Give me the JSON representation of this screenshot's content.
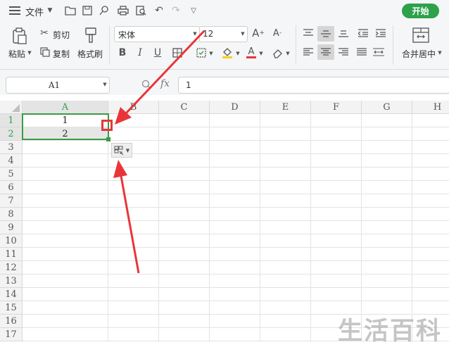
{
  "menubar": {
    "menu_icon": "hamburger-icon",
    "file_label": "文件",
    "start_label": "开始"
  },
  "ribbon": {
    "paste_label": "粘贴",
    "cut_label": "剪切",
    "copy_label": "复制",
    "format_painter_label": "格式刷",
    "font_name": "宋体",
    "font_size": "12",
    "merge_label": "合并居中"
  },
  "formula_bar": {
    "cell_ref": "A1",
    "fx_label": "fx",
    "formula_value": "1"
  },
  "sheet": {
    "columns": [
      "A",
      "B",
      "C",
      "D",
      "E",
      "F",
      "G",
      "H"
    ],
    "rows": [
      "1",
      "2",
      "3",
      "4",
      "5",
      "6",
      "7",
      "8",
      "9",
      "10",
      "11",
      "12",
      "13",
      "14",
      "15",
      "16",
      "17"
    ],
    "cells": {
      "A1": "1",
      "A2": "2"
    }
  },
  "watermark": "生活百科",
  "colors": {
    "accent_green": "#2ea14b",
    "annotation_red": "#e8353a",
    "selection_border": "#3b9b46"
  }
}
